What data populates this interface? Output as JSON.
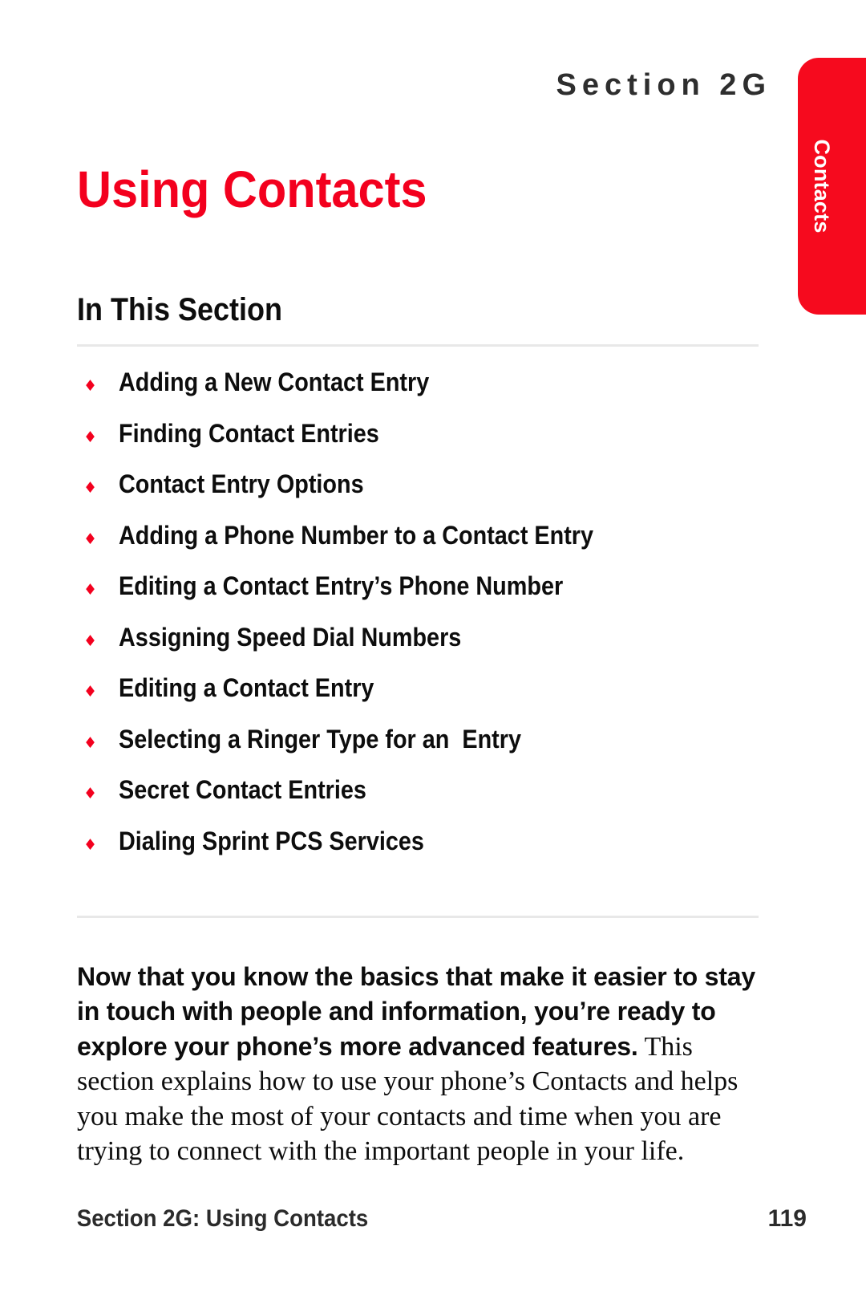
{
  "page": {
    "background_color": "#ffffff",
    "accent_color": "#F3001E",
    "tab_color": "#F60A1E",
    "rule_color": "#e8e8e8",
    "text_color": "#0d0d0d"
  },
  "header": {
    "eyebrow": "Section 2G",
    "title": "Using Contacts"
  },
  "side_tab": {
    "label": "Contacts"
  },
  "in_this_section": {
    "heading": "In This Section",
    "bullet_glyph": "♦",
    "items": [
      {
        "label": "Adding a New Contact Entry"
      },
      {
        "label": "Finding Contact Entries"
      },
      {
        "label": "Contact Entry Options"
      },
      {
        "label": "Adding a Phone Number to a Contact Entry"
      },
      {
        "label": "Editing a Contact Entry’s Phone Number"
      },
      {
        "label": "Assigning Speed Dial Numbers"
      },
      {
        "label": "Editing a Contact Entry"
      },
      {
        "label": "Selecting a Ringer Type for an  Entry"
      },
      {
        "label": "Secret Contact Entries"
      },
      {
        "label": "Dialing Sprint PCS Services"
      }
    ]
  },
  "intro": {
    "lead": "Now that you know the basics that make it easier to stay in touch with people and information, you’re ready to explore your phone’s more advanced features.",
    "rest": " This section explains how to use your phone’s Contacts and helps you make the most of your contacts and time when you are trying to connect with the important people in your life."
  },
  "footer": {
    "left": "Section 2G: Using Contacts",
    "page_number": "119"
  }
}
